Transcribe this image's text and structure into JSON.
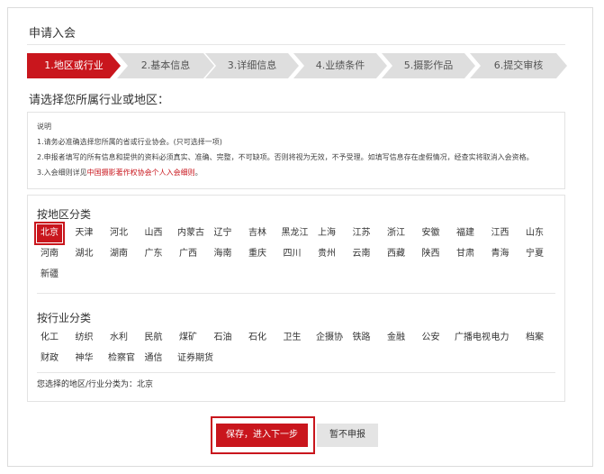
{
  "page": {
    "title": "申请入会",
    "prompt": "请选择您所属行业或地区："
  },
  "steps": [
    {
      "label": "1.地区或行业",
      "active": true
    },
    {
      "label": "2.基本信息",
      "active": false
    },
    {
      "label": "3.详细信息",
      "active": false
    },
    {
      "label": "4.业绩条件",
      "active": false
    },
    {
      "label": "5.摄影作品",
      "active": false
    },
    {
      "label": "6.提交审核",
      "active": false
    }
  ],
  "notes": {
    "heading": "说明",
    "line1": "1.请务必准确选择您所属的省或行业协会。(只可选择一项)",
    "line2": "2.申报者填写的所有信息和提供的资料必须真实、准确、完整，不可缺项。否则将视为无效，不予受理。如填写信息存在虚假情况，经查实将取消入会资格。",
    "line3_prefix": "3.入会细则详见",
    "line3_link": "中国摄影著作权协会个人入会细则",
    "line3_suffix": "。"
  },
  "region": {
    "title": "按地区分类",
    "selected": "北京",
    "items": [
      "北京",
      "天津",
      "河北",
      "山西",
      "内蒙古",
      "辽宁",
      "吉林",
      "黑龙江",
      "上海",
      "江苏",
      "浙江",
      "安徽",
      "福建",
      "江西",
      "山东",
      "河南",
      "湖北",
      "湖南",
      "广东",
      "广西",
      "海南",
      "重庆",
      "四川",
      "贵州",
      "云南",
      "西藏",
      "陕西",
      "甘肃",
      "青海",
      "宁夏",
      "新疆"
    ]
  },
  "industry": {
    "title": "按行业分类",
    "items": [
      "化工",
      "纺织",
      "水利",
      "民航",
      "煤矿",
      "石油",
      "石化",
      "卫生",
      "企摄协",
      "铁路",
      "金融",
      "公安",
      "广播电视",
      "电力",
      "档案",
      "财政",
      "神华",
      "检察官",
      "通信",
      "证券期货"
    ]
  },
  "summary": "您选择的地区/行业分类为：北京",
  "buttons": {
    "save": "保存，进入下一步",
    "skip": "暂不申报"
  },
  "colors": {
    "accent": "#c9161d",
    "step_inactive": "#dedede"
  }
}
